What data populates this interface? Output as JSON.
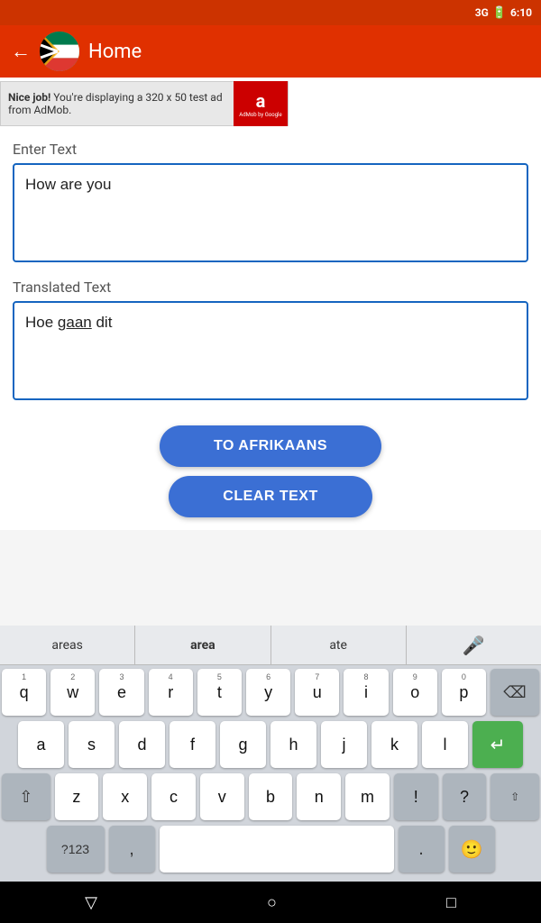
{
  "statusBar": {
    "signal": "3G",
    "signalBars": "▂▄",
    "battery": "🔋",
    "time": "6:10"
  },
  "topBar": {
    "backLabel": "←",
    "title": "Home"
  },
  "adBanner": {
    "niceLabel": "Nice job!",
    "adText": " You're displaying a 320 x 50 test ad from AdMob.",
    "logoSymbol": "a",
    "logoSub": "AdMob by Google"
  },
  "inputSection": {
    "enterTextLabel": "Enter Text",
    "inputValue": "How are you",
    "translatedTextLabel": "Translated Text",
    "translatedValue": "Hoe gaan dit"
  },
  "buttons": {
    "toAfrikaansLabel": "TO AFRIKAANS",
    "clearTextLabel": "CLEAR TEXT"
  },
  "keyboard": {
    "suggestions": [
      "areas",
      "area",
      "ate",
      "mic"
    ],
    "row1": [
      "q",
      "w",
      "e",
      "r",
      "t",
      "y",
      "u",
      "i",
      "o",
      "p"
    ],
    "row1nums": [
      "1",
      "2",
      "3",
      "4",
      "5",
      "6",
      "7",
      "8",
      "9",
      "0"
    ],
    "row2": [
      "a",
      "s",
      "d",
      "f",
      "g",
      "h",
      "j",
      "k",
      "l"
    ],
    "row3": [
      "z",
      "x",
      "c",
      "v",
      "b",
      "n",
      "m"
    ],
    "spaceLabel": "",
    "symbolsLabel": "?123",
    "commaLabel": ",",
    "periodLabel": ".",
    "emojiLabel": "🙂"
  },
  "navBar": {
    "backSymbol": "▽",
    "homeSymbol": "○",
    "recentSymbol": "□"
  }
}
